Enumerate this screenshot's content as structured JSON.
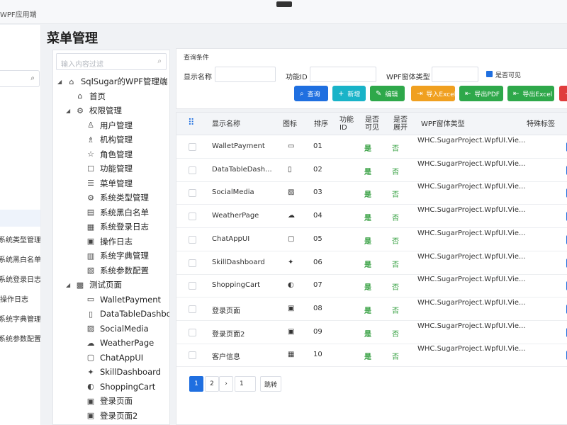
{
  "app": {
    "window_title": "WPF应用端"
  },
  "left_nav": {
    "items": [
      "",
      "",
      "",
      "",
      "",
      "系统类型管理",
      "系统黑白名单",
      "系统登录日志",
      "操作日志",
      "系统字典管理",
      "系统参数配置"
    ],
    "active_index": 4
  },
  "page_title": "菜单管理",
  "tree": {
    "filter_placeholder": "输入内容过滤",
    "nodes": [
      {
        "label": "SqlSugar的WPF管理端",
        "level": 0,
        "expanded": true,
        "icon": "home-icon",
        "glyph": "⌂"
      },
      {
        "label": "首页",
        "level": 1,
        "icon": "home-icon",
        "glyph": "⌂"
      },
      {
        "label": "权限管理",
        "level": 1,
        "expanded": true,
        "icon": "gear-icon",
        "glyph": "⚙"
      },
      {
        "label": "用户管理",
        "level": 2,
        "icon": "user-icon",
        "glyph": "♙"
      },
      {
        "label": "机构管理",
        "level": 2,
        "icon": "org-icon",
        "glyph": "♗"
      },
      {
        "label": "角色管理",
        "level": 2,
        "icon": "role-icon",
        "glyph": "☆"
      },
      {
        "label": "功能管理",
        "level": 2,
        "icon": "function-icon",
        "glyph": "☐"
      },
      {
        "label": "菜单管理",
        "level": 2,
        "icon": "menu-icon",
        "glyph": "☰"
      },
      {
        "label": "系统类型管理",
        "level": 2,
        "icon": "settings-icon",
        "glyph": "⚙"
      },
      {
        "label": "系统黑白名单",
        "level": 2,
        "icon": "list-icon",
        "glyph": "▤"
      },
      {
        "label": "系统登录日志",
        "level": 2,
        "icon": "log-icon",
        "glyph": "▦"
      },
      {
        "label": "操作日志",
        "level": 2,
        "icon": "operation-log-icon",
        "glyph": "▣"
      },
      {
        "label": "系统字典管理",
        "level": 2,
        "icon": "dictionary-icon",
        "glyph": "▥"
      },
      {
        "label": "系统参数配置",
        "level": 2,
        "icon": "params-icon",
        "glyph": "▧"
      },
      {
        "label": "测试页面",
        "level": 1,
        "expanded": true,
        "icon": "test-icon",
        "glyph": "▩"
      },
      {
        "label": "WalletPayment",
        "level": 2,
        "icon": "wallet-icon",
        "glyph": "▭"
      },
      {
        "label": "DataTableDashboa",
        "level": 2,
        "icon": "clipboard-icon",
        "glyph": "▯"
      },
      {
        "label": "SocialMedia",
        "level": 2,
        "icon": "social-icon",
        "glyph": "▨"
      },
      {
        "label": "WeatherPage",
        "level": 2,
        "icon": "weather-icon",
        "glyph": "☁"
      },
      {
        "label": "ChatAppUI",
        "level": 2,
        "icon": "chat-icon",
        "glyph": "▢"
      },
      {
        "label": "SkillDashboard",
        "level": 2,
        "icon": "skill-icon",
        "glyph": "✦"
      },
      {
        "label": "ShoppingCart",
        "level": 2,
        "icon": "cart-icon",
        "glyph": "◐"
      },
      {
        "label": "登录页面",
        "level": 2,
        "icon": "login-icon",
        "glyph": "▣"
      },
      {
        "label": "登录页面2",
        "level": 2,
        "icon": "login-icon",
        "glyph": "▣"
      }
    ]
  },
  "query": {
    "title": "查询条件",
    "display_name_label": "显示名称",
    "function_id_label": "功能ID",
    "wpf_type_label": "WPF窗体类型",
    "visible_label": "是否可见",
    "display_name_value": "",
    "function_id_value": "",
    "wpf_type_value": "",
    "buttons": [
      {
        "label": "查询",
        "glyph": "⌕",
        "color": "#1f6fe0",
        "name": "search-button",
        "icon": "search-icon"
      },
      {
        "label": "新增",
        "glyph": "+",
        "color": "#19b3c8",
        "name": "add-button",
        "icon": "plus-icon"
      },
      {
        "label": "编辑",
        "glyph": "✎",
        "color": "#2ea84a",
        "name": "edit-button",
        "icon": "edit-icon"
      },
      {
        "label": "导入Excel",
        "glyph": "⇥",
        "color": "#f0a020",
        "name": "import-excel-button",
        "icon": "import-icon"
      },
      {
        "label": "导出PDF",
        "glyph": "⇤",
        "color": "#2ea84a",
        "name": "export-pdf-button",
        "icon": "export-icon"
      },
      {
        "label": "导出Excel",
        "glyph": "⇤",
        "color": "#2ea84a",
        "name": "export-excel-button",
        "icon": "export-icon"
      },
      {
        "label": "",
        "glyph": "−",
        "color": "#e03c3c",
        "name": "delete-button",
        "icon": "delete-icon"
      }
    ]
  },
  "grid": {
    "headers": {
      "select_glyph": "⠿",
      "display_name": "显示名称",
      "icon": "图标",
      "order": "排序",
      "function_id": "功能\nID",
      "visible": "是否\n可见",
      "expand": "是否\n展开",
      "wpf_type": "WPF窗体类型",
      "special_tag": "特殊标签"
    },
    "rows": [
      {
        "name": "WalletPayment",
        "icon_glyph": "▭",
        "order": "01",
        "visible": "是",
        "expand": "否",
        "wpf_type": "WHC.SugarProject.WpfUI.Vie..."
      },
      {
        "name": "DataTableDash...",
        "icon_glyph": "▯",
        "order": "02",
        "visible": "是",
        "expand": "否",
        "wpf_type": "WHC.SugarProject.WpfUI.Vie..."
      },
      {
        "name": "SocialMedia",
        "icon_glyph": "▨",
        "order": "03",
        "visible": "是",
        "expand": "否",
        "wpf_type": "WHC.SugarProject.WpfUI.Vie..."
      },
      {
        "name": "WeatherPage",
        "icon_glyph": "☁",
        "order": "04",
        "visible": "是",
        "expand": "否",
        "wpf_type": "WHC.SugarProject.WpfUI.Vie..."
      },
      {
        "name": "ChatAppUI",
        "icon_glyph": "▢",
        "order": "05",
        "visible": "是",
        "expand": "否",
        "wpf_type": "WHC.SugarProject.WpfUI.Vie..."
      },
      {
        "name": "SkillDashboard",
        "icon_glyph": "✦",
        "order": "06",
        "visible": "是",
        "expand": "否",
        "wpf_type": "WHC.SugarProject.WpfUI.Vie..."
      },
      {
        "name": "ShoppingCart",
        "icon_glyph": "◐",
        "order": "07",
        "visible": "是",
        "expand": "否",
        "wpf_type": "WHC.SugarProject.WpfUI.Vie..."
      },
      {
        "name": "登录页面",
        "icon_glyph": "▣",
        "order": "08",
        "visible": "是",
        "expand": "否",
        "wpf_type": "WHC.SugarProject.WpfUI.Vie..."
      },
      {
        "name": "登录页面2",
        "icon_glyph": "▣",
        "order": "09",
        "visible": "是",
        "expand": "否",
        "wpf_type": "WHC.SugarProject.WpfUI.Vie..."
      },
      {
        "name": "客户信息",
        "icon_glyph": "▦",
        "order": "10",
        "visible": "是",
        "expand": "否",
        "wpf_type": "WHC.SugarProject.WpfUI.Vie..."
      }
    ]
  },
  "pager": {
    "pages": [
      "1",
      "2"
    ],
    "current_page": "1",
    "prev_glyph": "‹",
    "next_glyph": "›",
    "jump_value": "1",
    "jump_label": "跳转"
  }
}
